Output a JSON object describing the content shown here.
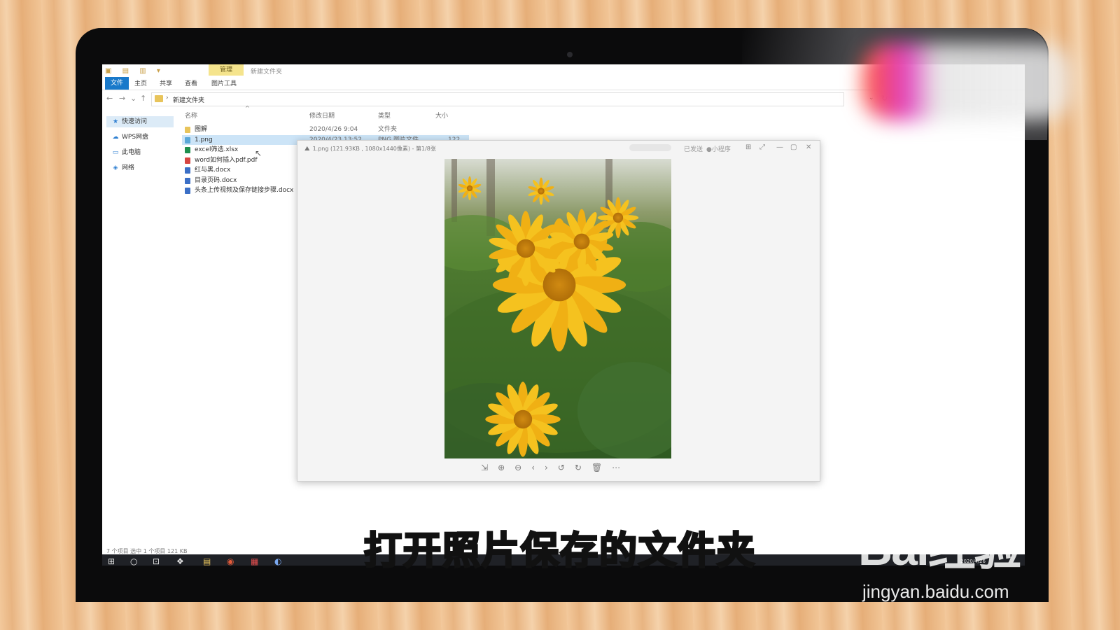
{
  "explorer": {
    "quick_access_icons": "▣ ▤ ▥ ▾",
    "context_tab": "管理",
    "window_title": "新建文件夹",
    "ribbon_tabs": [
      "文件",
      "主页",
      "共享",
      "查看",
      "图片工具"
    ],
    "address_path": "新建文件夹",
    "nav_items": [
      "快速访问",
      "WPS网盘",
      "此电脑",
      "网络"
    ],
    "columns": [
      "名称",
      "修改日期",
      "类型",
      "大小"
    ],
    "files": [
      {
        "name": "图解",
        "date": "2020/4/26 9:04",
        "type": "文件夹",
        "size": "",
        "selected": false,
        "color": "#e8c45b"
      },
      {
        "name": "1.png",
        "date": "2020/4/23 13:52",
        "type": "PNG 图片文件",
        "size": "122 KB",
        "selected": true,
        "color": "#5aa8d8"
      },
      {
        "name": "excel筛选.xlsx",
        "date": "",
        "type": "",
        "size": "",
        "selected": false,
        "color": "#1e8f4e"
      },
      {
        "name": "word如何插入pdf.pdf",
        "date": "",
        "type": "",
        "size": "",
        "selected": false,
        "color": "#d64541"
      },
      {
        "name": "红与黑.docx",
        "date": "",
        "type": "",
        "size": "",
        "selected": false,
        "color": "#3b6fc6"
      },
      {
        "name": "目录页码.docx",
        "date": "",
        "type": "",
        "size": "",
        "selected": false,
        "color": "#3b6fc6"
      },
      {
        "name": "头条上传视频及保存链接步骤.docx",
        "date": "",
        "type": "",
        "size": "",
        "selected": false,
        "color": "#3b6fc6"
      }
    ],
    "status_text": "7 个项目    选中 1 个项目  121 KB"
  },
  "viewer": {
    "title": "1.png (121.93KB , 1080x1440像素) - 第1/8张",
    "top_right_a": "已发送",
    "top_right_b": "小程序",
    "window_buttons": [
      "⊞",
      "⤢",
      "—",
      "▢",
      "✕"
    ],
    "toolbar_icons": [
      "⇲",
      "⊕",
      "⊖",
      "‹",
      "›",
      "↺",
      "↻",
      "🗑",
      "⋯"
    ]
  },
  "taskbar": {
    "icons": [
      "⊞",
      "○",
      "⊡",
      "❖",
      "▤",
      "◉",
      "▦",
      "◐"
    ],
    "date": "2020/4/26"
  },
  "subtitle": "打开照片保存的文件夹",
  "watermark": {
    "logo": "Bai经验",
    "url": "jingyan.baidu.com"
  },
  "colors": {
    "ribbon_accent": "#1979ca",
    "selection": "#cce4f7",
    "flower_yellow": "#f2b51b"
  }
}
